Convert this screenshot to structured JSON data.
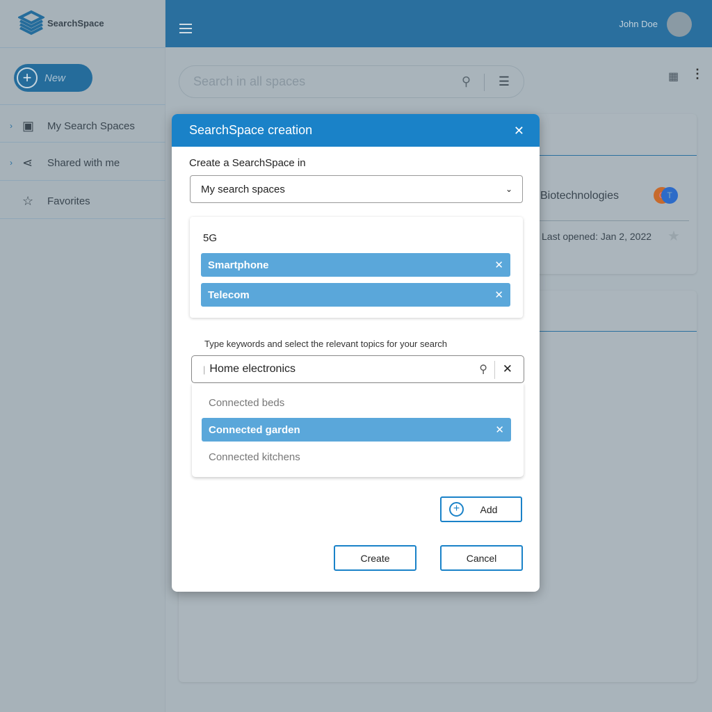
{
  "app": {
    "logo_text": "SearchSpace",
    "new_label": "New",
    "user_name": "John Doe"
  },
  "sidebar": {
    "items": [
      {
        "label": "My Search Spaces"
      },
      {
        "label": "Shared with me"
      },
      {
        "label": "Favorites"
      }
    ]
  },
  "search": {
    "placeholder": "Search in all spaces"
  },
  "background_card": {
    "title": "Biotechnologies",
    "last_opened": "Last opened: Jan 2, 2022",
    "avatars": [
      "C",
      "T"
    ]
  },
  "dialog": {
    "title": "SearchSpace creation",
    "create_in_label": "Create a SearchSpace in",
    "create_in_value": "My search spaces",
    "topic_heading": "5G",
    "selected_topics": [
      "Smartphone",
      "Telecom"
    ],
    "hint": "Type keywords and select the relevant topics for your search",
    "keyword_value": "Home electronics",
    "suggestions": [
      "Connected beds",
      "Connected garden",
      "Connected kitchens"
    ],
    "add_label": "Add",
    "create_label": "Create",
    "cancel_label": "Cancel"
  },
  "colors": {
    "header": "#2a6f9e",
    "dialog_header": "#1a82c8",
    "chip": "#5aa7da"
  }
}
